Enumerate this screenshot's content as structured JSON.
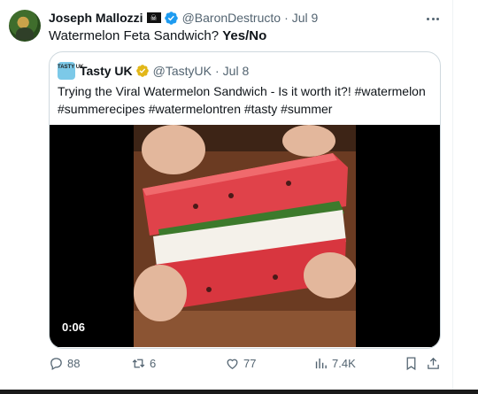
{
  "tweet": {
    "author_name": "Joseph Mallozzi",
    "author_handle": "@BaronDestructo",
    "separator": "·",
    "time": "Jul 9",
    "text": "Watermelon Feta Sandwich?",
    "text_bold": "Yes/No",
    "flag_glyph": "☠",
    "avatar_icon": "profile-photo",
    "more_icon": "ellipsis-icon"
  },
  "quote": {
    "avatar_text": "TASTY UK",
    "author_name": "Tasty UK",
    "author_handle": "@TastyUK",
    "separator": "·",
    "time": "Jul 8",
    "text_line1": "Trying the Viral Watermelon Sandwich - Is it worth it?! #watermelon",
    "text_line2": "#summerecipes #watermelontren #tasty #summer",
    "video_duration": "0:06"
  },
  "actions": {
    "replies": "88",
    "reposts": "6",
    "likes": "77",
    "views": "7.4K"
  },
  "colors": {
    "verified_blue": "#1d9bf0",
    "gold_badge": "#e2b719",
    "secondary_text": "#536471",
    "border": "#cfd9de"
  }
}
